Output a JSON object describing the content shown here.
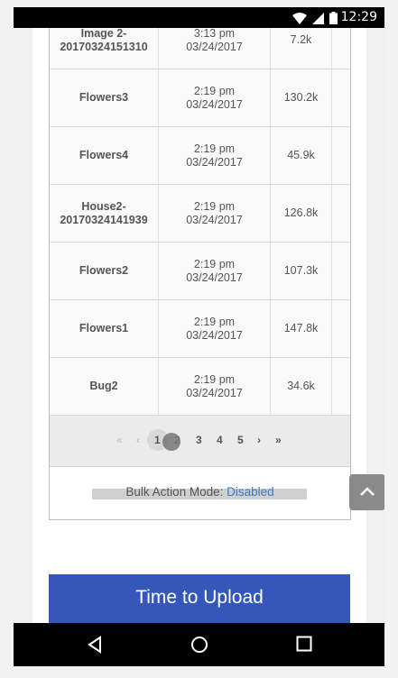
{
  "status_bar": {
    "time": "12:29",
    "icons": [
      "wifi-icon",
      "signal-icon",
      "battery-icon"
    ]
  },
  "table": {
    "rows": [
      {
        "name": "Image 2-\n20170324151310",
        "time": "3:13 pm",
        "date": "03/24/2017",
        "size": "7.2k"
      },
      {
        "name": "Flowers3",
        "time": "2:19 pm",
        "date": "03/24/2017",
        "size": "130.2k"
      },
      {
        "name": "Flowers4",
        "time": "2:19 pm",
        "date": "03/24/2017",
        "size": "45.9k"
      },
      {
        "name": "House2-\n20170324141939",
        "time": "2:19 pm",
        "date": "03/24/2017",
        "size": "126.8k"
      },
      {
        "name": "Flowers2",
        "time": "2:19 pm",
        "date": "03/24/2017",
        "size": "107.3k"
      },
      {
        "name": "Flowers1",
        "time": "2:19 pm",
        "date": "03/24/2017",
        "size": "147.8k"
      },
      {
        "name": "Bug2",
        "time": "2:19 pm",
        "date": "03/24/2017",
        "size": "34.6k"
      }
    ]
  },
  "pagination": {
    "first": "«",
    "prev": "‹",
    "pages": [
      "1",
      "2",
      "3",
      "4",
      "5"
    ],
    "next": "›",
    "last": "»",
    "current": "1"
  },
  "bulk": {
    "label": "Bulk Action Mode:",
    "value": "Disabled"
  },
  "upload_button": "Time to Upload",
  "colors": {
    "accent": "#3557b9",
    "link": "#3a7bbf"
  }
}
